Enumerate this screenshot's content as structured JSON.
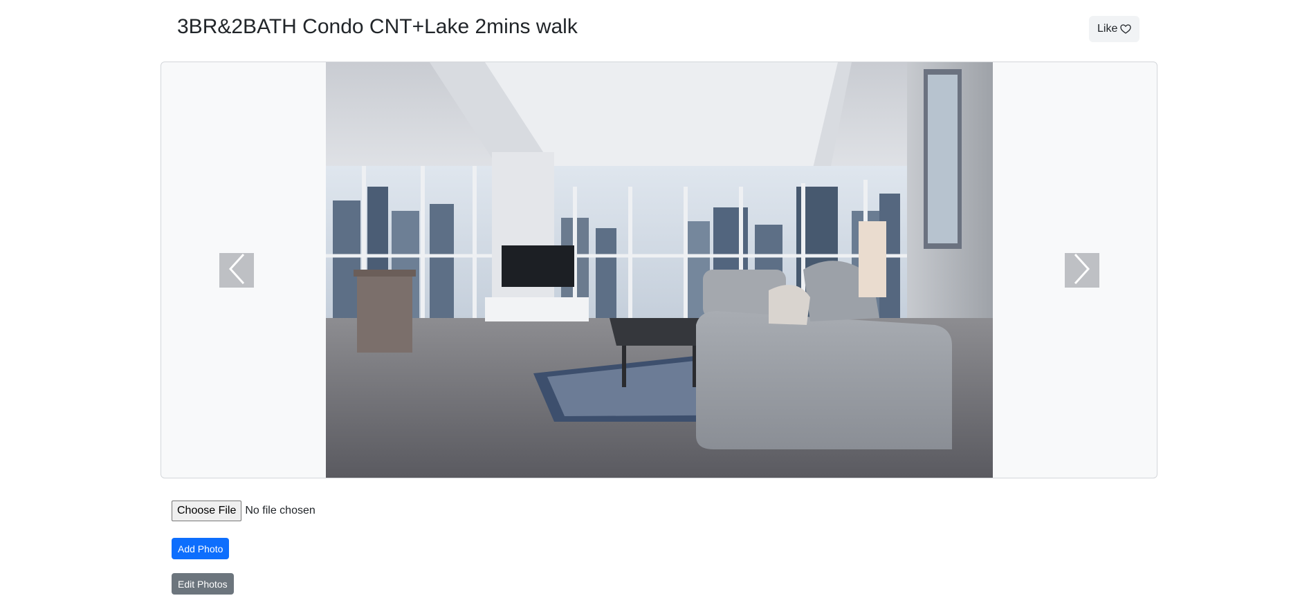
{
  "listing": {
    "title": "3BR&2BATH Condo CNT+Lake 2mins walk"
  },
  "like": {
    "label": "Like",
    "icon": "heart-outline-icon"
  },
  "carousel": {
    "prev_icon": "chevron-left-icon",
    "next_icon": "chevron-right-icon",
    "photo_subject": "living-room-photo"
  },
  "upload": {
    "choose_file_label": "Choose File",
    "file_status": "No file chosen"
  },
  "actions": {
    "add_photo_label": "Add Photo",
    "edit_photos_label": "Edit Photos"
  },
  "colors": {
    "primary": "#0d6efd",
    "secondary": "#6c757d",
    "like_bg": "#f1f3f5",
    "carousel_bg": "#f8f9fa"
  }
}
